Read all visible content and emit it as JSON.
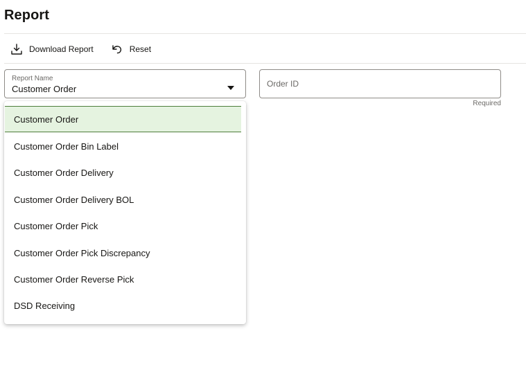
{
  "page": {
    "title": "Report"
  },
  "toolbar": {
    "download_label": "Download Report",
    "download_icon": "download-icon",
    "reset_label": "Reset",
    "reset_icon": "undo-icon"
  },
  "report_name_field": {
    "label": "Report Name",
    "value": "Customer Order",
    "expanded": true
  },
  "order_id_field": {
    "placeholder": "Order ID",
    "value": "",
    "hint": "Required"
  },
  "dropdown": {
    "selected_index": 0,
    "options": [
      "Customer Order",
      "Customer Order Bin Label",
      "Customer Order Delivery",
      "Customer Order Delivery BOL",
      "Customer Order Pick",
      "Customer Order Pick Discrepancy",
      "Customer Order Reverse Pick",
      "DSD Receiving"
    ]
  },
  "colors": {
    "selected_background": "#e5f3e0",
    "selected_border": "#4d7d3a",
    "border": "#8e8b87",
    "text": "#161513",
    "muted_text": "#6b6966"
  }
}
